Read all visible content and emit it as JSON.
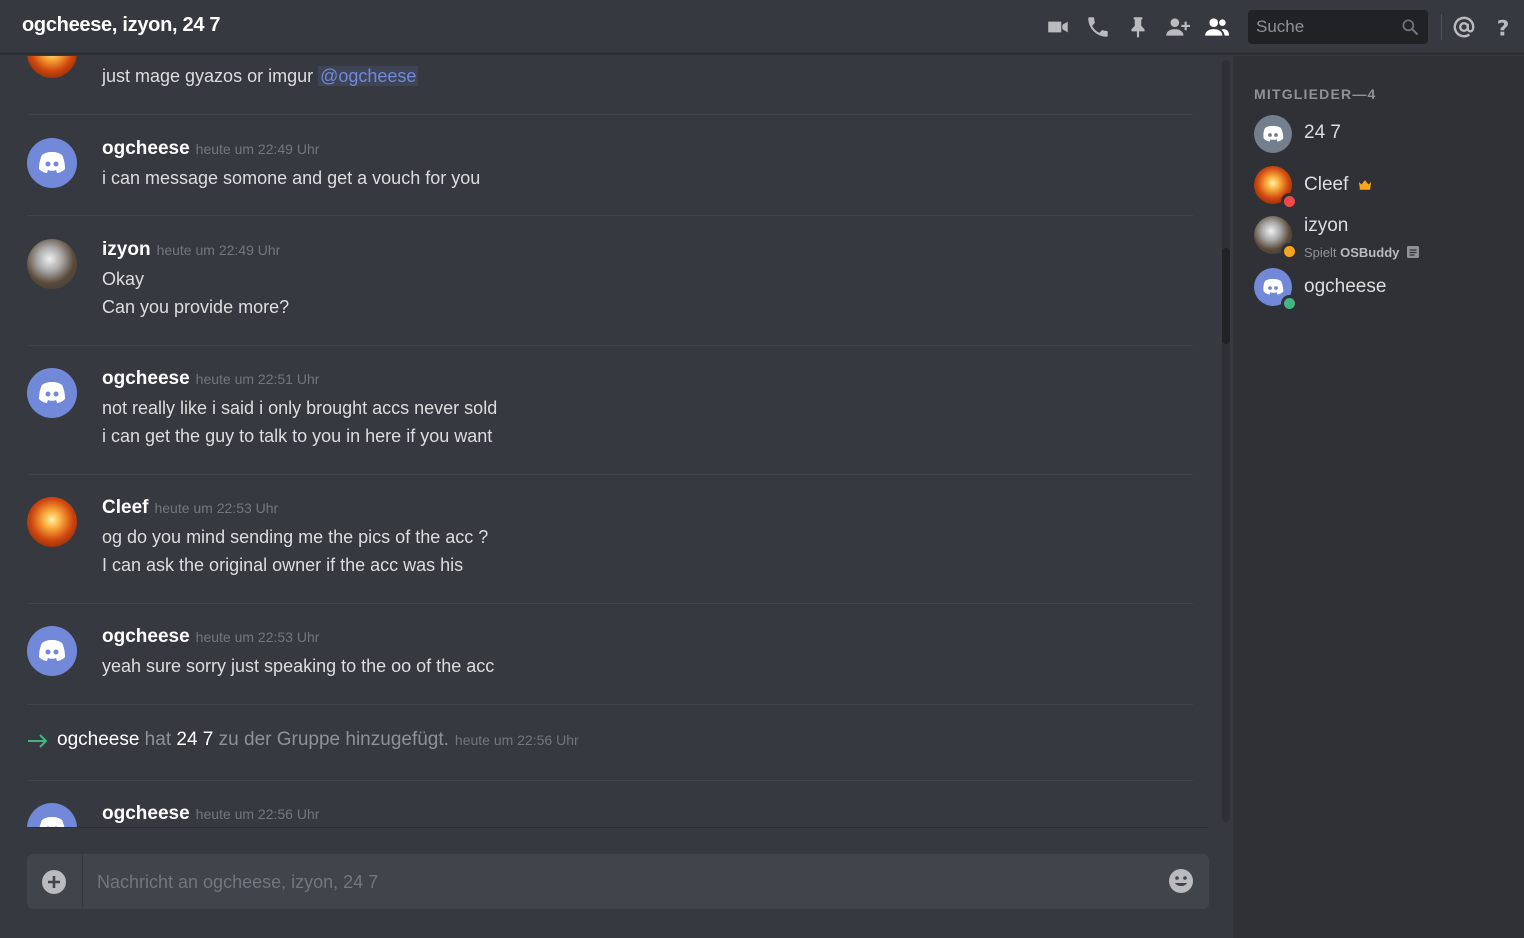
{
  "header": {
    "title": "ogcheese, izyon, 24 7",
    "search_placeholder": "Suche"
  },
  "messages": [
    {
      "line": "just mage gyazos or imgur ",
      "mention": "@ogcheese"
    },
    {
      "author": "ogcheese",
      "timestamp": "heute um 22:49 Uhr",
      "lines": [
        "i can message somone and get a vouch for you"
      ]
    },
    {
      "author": "izyon",
      "timestamp": "heute um 22:49 Uhr",
      "lines": [
        "Okay",
        "Can you provide more?"
      ]
    },
    {
      "author": "ogcheese",
      "timestamp": "heute um 22:51 Uhr",
      "lines": [
        "not really like i said i only brought accs never sold",
        "i can get the guy to talk to you in here if you want"
      ]
    },
    {
      "author": "Cleef",
      "timestamp": "heute um 22:53 Uhr",
      "lines": [
        "og do you mind sending me the pics of the acc ?",
        "I can ask the original owner if the acc was his"
      ]
    },
    {
      "author": "ogcheese",
      "timestamp": "heute um 22:53 Uhr",
      "lines": [
        "yeah sure sorry just speaking to the oo of the acc"
      ]
    },
    {
      "author": "ogcheese",
      "timestamp": "heute um 22:56 Uhr",
      "lines": []
    }
  ],
  "system_message": {
    "actor": "ogcheese",
    "text_before": " hat ",
    "target": "24 7",
    "text_after": " zu der Gruppe hinzugefügt.",
    "timestamp": "heute um 22:56 Uhr"
  },
  "composer": {
    "placeholder": "Nachricht an ogcheese, izyon, 24 7"
  },
  "members": {
    "header": "MITGLIEDER—4",
    "list": [
      {
        "name": "24 7",
        "status": "none"
      },
      {
        "name": "Cleef",
        "status": "dnd",
        "owner_icon": "crown-icon"
      },
      {
        "name": "izyon",
        "status": "idle",
        "activity_prefix": "Spielt ",
        "activity_name": "OSBuddy"
      },
      {
        "name": "ogcheese",
        "status": "online"
      }
    ]
  },
  "colors": {
    "background": "#36393f",
    "sidebar": "#2f3136",
    "blurple": "#7289da",
    "online": "#43b581",
    "idle": "#faa61a",
    "dnd": "#f04747",
    "crown": "#faa61a"
  }
}
